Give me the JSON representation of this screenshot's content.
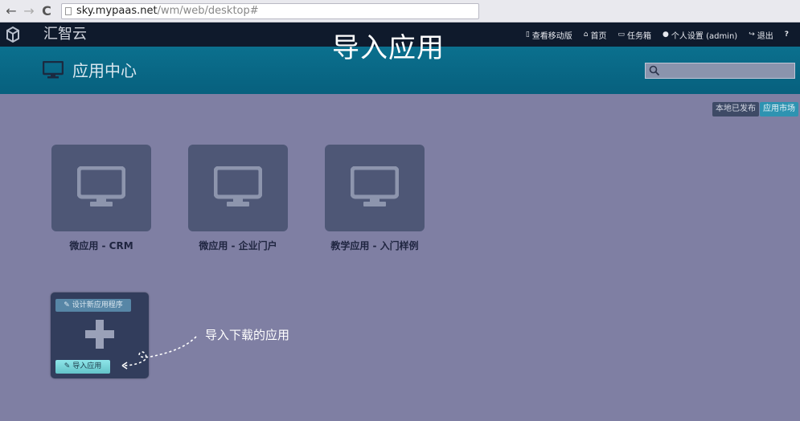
{
  "browser": {
    "back": "←",
    "forward": "→",
    "reload": "C",
    "url_host": "sky.mypaas.net",
    "url_path": "/wm/web/desktop#"
  },
  "topbar": {
    "brand": "汇智云",
    "overlay_title": "导入应用",
    "nav": [
      {
        "icon": "▯",
        "label": "查看移动版"
      },
      {
        "icon": "⌂",
        "label": "首页"
      },
      {
        "icon": "▭",
        "label": "任务箱"
      },
      {
        "icon": "●",
        "label": "个人设置 (admin)"
      },
      {
        "icon": "↪",
        "label": "退出"
      },
      {
        "icon": "?",
        "label": ""
      }
    ]
  },
  "header": {
    "title": "应用中心",
    "search_placeholder": ""
  },
  "buttons": {
    "local_published": "本地已发布",
    "app_market": "应用市场"
  },
  "apps": [
    {
      "label": "微应用 - CRM"
    },
    {
      "label": "微应用 - 企业门户"
    },
    {
      "label": "教学应用 - 入门样例"
    }
  ],
  "add_tile": {
    "design_button": "✎ 设计新应用程序",
    "import_button": "✎ 导入应用"
  },
  "annotation": {
    "text": "导入下载的应用"
  },
  "colors": {
    "topbar": "#0f1a2c",
    "header_band": "#07607e",
    "page_bg": "#7f7fa3",
    "tile": "#4e5776",
    "market_button": "#2e93b1"
  },
  "icons": {
    "app_tile": "monitor-icon",
    "add": "plus-icon",
    "search": "search-icon"
  }
}
